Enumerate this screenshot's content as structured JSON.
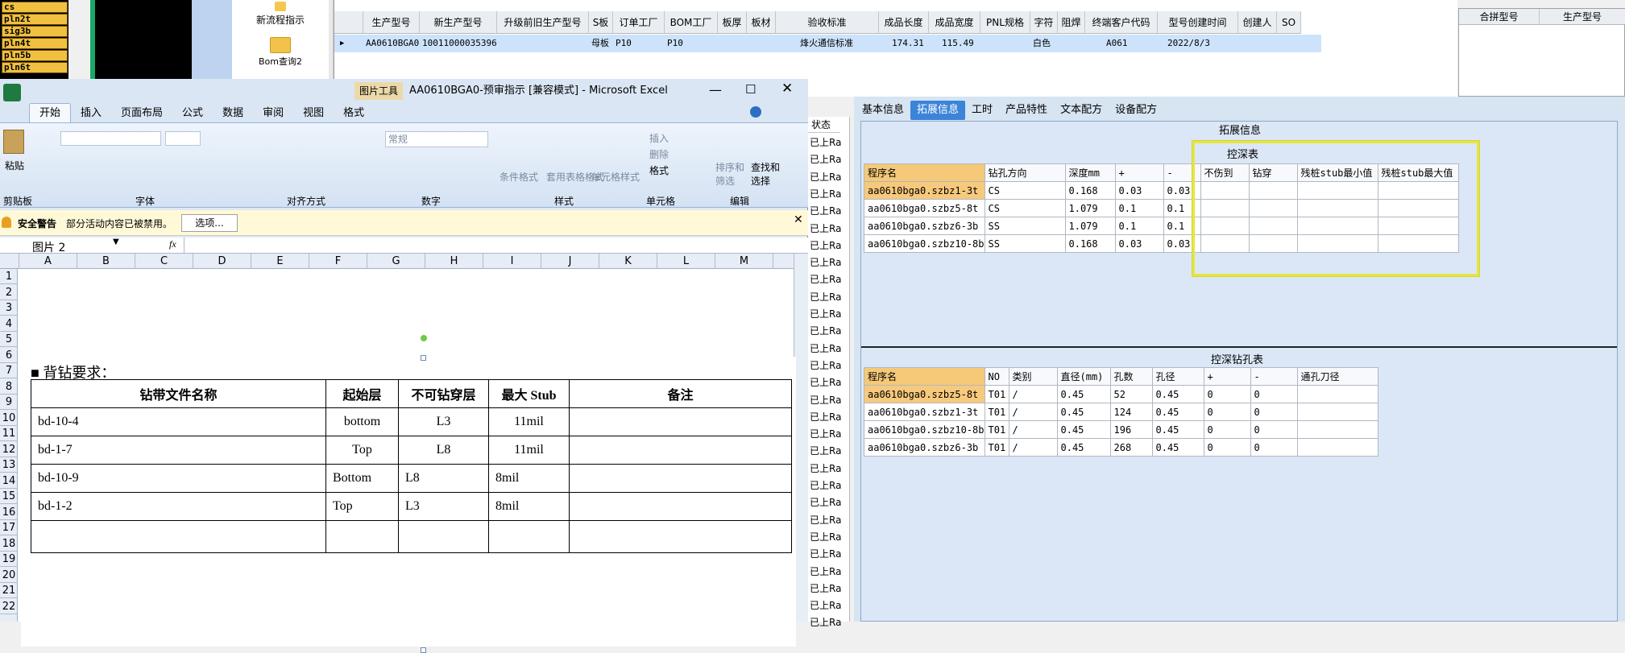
{
  "layers": [
    "cs",
    "pln2t",
    "sig3b",
    "pln4t",
    "pln5b",
    "pln6t"
  ],
  "launcher": {
    "new_flow": "新流程指示",
    "bom_query": "Bom查询2"
  },
  "top_grid": {
    "headers": [
      "生产型号",
      "新生产型号",
      "升级前旧生产型号",
      "S板",
      "订单工厂",
      "BOM工厂",
      "板厚",
      "板材",
      "验收标准",
      "成品长度",
      "成品宽度",
      "PNL规格",
      "字符",
      "阻焊",
      "终端客户代码",
      "型号创建时间",
      "创建人",
      "SO"
    ],
    "row": [
      "AA0610BGA0",
      "10011000035396",
      "",
      "母板",
      "P10",
      "P10",
      "",
      "",
      "烽火通信标准",
      "174.31",
      "115.49",
      "",
      "白色",
      "",
      "A061",
      "2022/8/3",
      "",
      ""
    ],
    "right_headers": [
      "合拼型号",
      "生产型号"
    ]
  },
  "tabs": [
    "基本信息",
    "拓展信息",
    "工时",
    "产品特性",
    "文本配方",
    "设备配方"
  ],
  "active_tab": "拓展信息",
  "status_header": "状态",
  "status_items": [
    "已上Ra",
    "已上Ra",
    "已上Ra",
    "已上Ra",
    "已上Ra",
    "已上Ra",
    "已上Ra",
    "已上Ra",
    "已上Ra",
    "已上Ra",
    "已上Ra",
    "已上Ra",
    "已上Ra",
    "已上Ra",
    "已上Ra",
    "已上Ra",
    "已上Ra",
    "已上Ra",
    "已上Ra",
    "已上Ra",
    "已上Ra",
    "已上Ra",
    "已上Ra",
    "已上Ra",
    "已上Ra",
    "已上Ra",
    "已上Ra",
    "已上Ra",
    "已上Ra"
  ],
  "ext_info": {
    "group_title": "拓展信息",
    "depth_title": "控深表",
    "depth_headers": [
      "程序名",
      "钻孔方向",
      "深度mm",
      "+",
      "-",
      "不伤到",
      "钻穿",
      "残桩stub最小值",
      "残桩stub最大值"
    ],
    "depth_rows": [
      [
        "aa0610bga0.szbz1-3t",
        "CS",
        "0.168",
        "0.03",
        "0.03",
        "",
        "",
        "",
        ""
      ],
      [
        "aa0610bga0.szbz5-8t",
        "CS",
        "1.079",
        "0.1",
        "0.1",
        "",
        "",
        "",
        ""
      ],
      [
        "aa0610bga0.szbz6-3b",
        "SS",
        "1.079",
        "0.1",
        "0.1",
        "",
        "",
        "",
        ""
      ],
      [
        "aa0610bga0.szbz10-8b",
        "SS",
        "0.168",
        "0.03",
        "0.03",
        "",
        "",
        "",
        ""
      ]
    ],
    "hole_title": "控深钻孔表",
    "hole_headers": [
      "程序名",
      "NO",
      "类别",
      "直径(mm)",
      "孔数",
      "孔径",
      "+",
      "-",
      "通孔刀径"
    ],
    "hole_rows": [
      [
        "aa0610bga0.szbz5-8t",
        "T01",
        "/",
        "0.45",
        "52",
        "0.45",
        "0",
        "0",
        ""
      ],
      [
        "aa0610bga0.szbz1-3t",
        "T01",
        "/",
        "0.45",
        "124",
        "0.45",
        "0",
        "0",
        ""
      ],
      [
        "aa0610bga0.szbz10-8b",
        "T01",
        "/",
        "0.45",
        "196",
        "0.45",
        "0",
        "0",
        ""
      ],
      [
        "aa0610bga0.szbz6-3b",
        "T01",
        "/",
        "0.45",
        "268",
        "0.45",
        "0",
        "0",
        ""
      ]
    ]
  },
  "excel": {
    "picture_tools": "图片工具",
    "title": "AA0610BGA0-预审指示 [兼容模式] - Microsoft Excel",
    "ribbon_tabs": [
      "开始",
      "插入",
      "页面布局",
      "公式",
      "数据",
      "审阅",
      "视图",
      "格式"
    ],
    "groups": [
      "剪贴板",
      "字体",
      "对齐方式",
      "数字",
      "样式",
      "单元格",
      "编辑"
    ],
    "paste_label": "粘贴",
    "number_format": "常规",
    "style_buttons": [
      "条件格式",
      "套用表格格式",
      "单元格样式"
    ],
    "cell_buttons": [
      "插入",
      "删除",
      "格式"
    ],
    "edit_buttons": [
      "排序和筛选",
      "查找和选择"
    ],
    "security_label": "安全警告",
    "security_text": "部分活动内容已被禁用。",
    "options_button": "选项...",
    "name_box": "图片 2",
    "fx": "fx",
    "columns": [
      "A",
      "B",
      "C",
      "D",
      "E",
      "F",
      "G",
      "H",
      "I",
      "J",
      "K",
      "L",
      "M"
    ],
    "rows": [
      "1",
      "2",
      "3",
      "4",
      "5",
      "6",
      "7",
      "8",
      "9",
      "10",
      "11",
      "12",
      "13",
      "14",
      "15",
      "16",
      "17",
      "18",
      "19",
      "20",
      "21",
      "22"
    ],
    "doc_heading": "■  背钻要求：",
    "doc_table_headers": [
      "钻带文件名称",
      "起始层",
      "不可钻穿层",
      "最大 Stub",
      "备注"
    ],
    "doc_table_rows": [
      [
        "bd-10-4",
        "bottom",
        "L3",
        "11mil",
        ""
      ],
      [
        "bd-1-7",
        "Top",
        "L8",
        "11mil",
        ""
      ],
      [
        "bd-10-9",
        "Bottom",
        "L8",
        "8mil",
        ""
      ],
      [
        "bd-1-2",
        "Top",
        "L3",
        "8mil",
        ""
      ],
      [
        "",
        "",
        "",
        "",
        ""
      ]
    ]
  }
}
